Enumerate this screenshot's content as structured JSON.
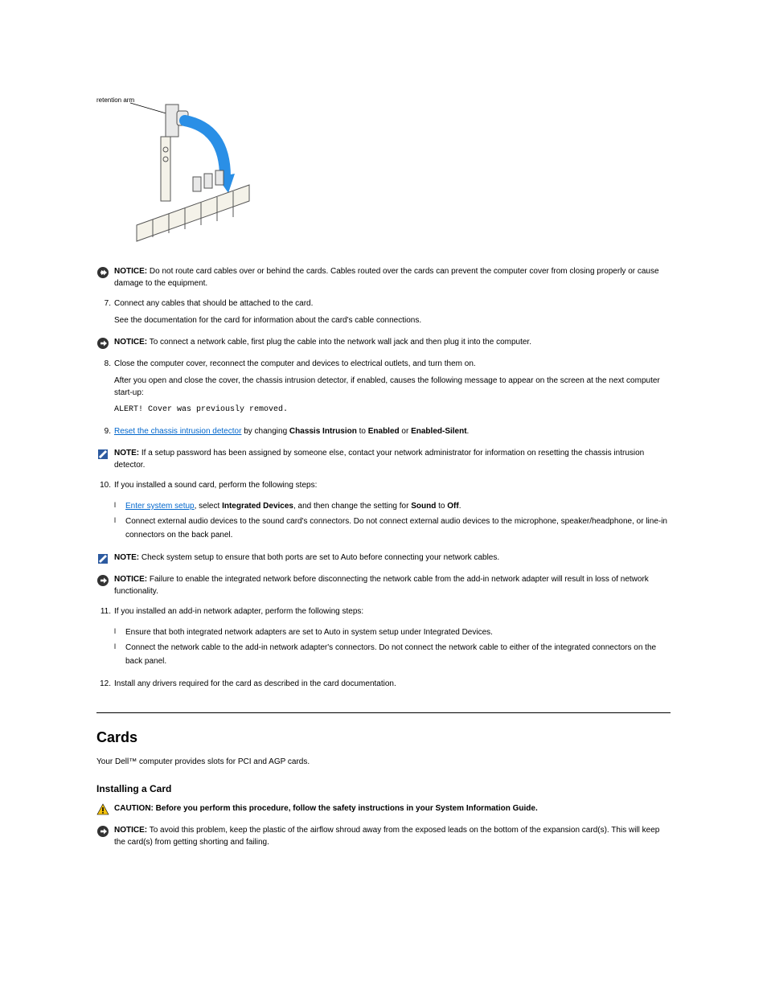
{
  "figure": {
    "label": "retention arm"
  },
  "notice7": {
    "label": "NOTICE:",
    "text": "Do not route card cables over or behind the cards. Cables routed over the cards can prevent the computer cover from closing properly or cause damage to the equipment."
  },
  "step7": {
    "num": "7.",
    "text": "Connect any cables that should be attached to the card.",
    "sub": "See the documentation for the card for information about the card's cable connections."
  },
  "notice8": {
    "label": "NOTICE:",
    "text": "To connect a network cable, first plug the cable into the network wall jack and then plug it into the computer."
  },
  "step8": {
    "num": "8.",
    "text": "Close the computer cover, reconnect the computer and devices to electrical outlets, and turn them on.",
    "sub_before": "After you open and close the cover, the chassis intrusion detector, if enabled, causes the following message to appear on the screen at the next computer start-up:",
    "code": "ALERT! Cover was previously removed."
  },
  "step9": {
    "num": "9.",
    "text_before": "Reset the chassis intrusion detector",
    "link": " by changing ",
    "text_after": "Chassis Intrusion to Enabled or Enabled-Silent.",
    "link_text": "Reset the chassis intrusion detector"
  },
  "note9": {
    "label": "NOTE:",
    "text": "If a setup password has been assigned by someone else, contact your network administrator for information on resetting the chassis intrusion detector."
  },
  "step10": {
    "num": "10.",
    "text": "If you installed a sound card, perform the following steps:",
    "items": [
      "Enter system setup, select Integrated Devices, and then change the setting for Sound to Off.",
      "Connect external audio devices to the sound card's connectors. Do not connect external audio devices to the microphone, speaker/headphone, or line-in connectors on the back panel."
    ]
  },
  "note10": {
    "label": "NOTE:",
    "text": "Check system setup to ensure that both ports are set to Auto before connecting your network cables."
  },
  "notice10": {
    "label": "NOTICE:",
    "text": "Failure to enable the integrated network before disconnecting the network cable from the add-in network adapter will result in loss of network functionality."
  },
  "step11": {
    "num": "11.",
    "text": "If you installed an add-in network adapter, perform the following steps:",
    "items": [
      "Ensure that both integrated network adapters are set to Auto in system setup under Integrated Devices.",
      "Connect the network cable to the add-in network adapter's connectors. Do not connect the network cable to either of the integrated connectors on the back panel."
    ]
  },
  "step12": {
    "num": "12.",
    "text": "Install any drivers required for the card as described in the card documentation."
  },
  "cards": {
    "title": "Cards",
    "intro": "Your Dell™ computer provides slots for PCI and AGP cards.",
    "sub_title": "Installing a Card",
    "caution": {
      "label": "CAUTION:",
      "text": "Before you perform this procedure, follow the safety instructions in your System Information Guide."
    },
    "notice": {
      "label": "NOTICE:",
      "text": "To avoid this problem, keep the plastic of the airflow shroud away from the exposed leads on the bottom of the expansion card(s). This will keep the card(s) from getting shorting and failing."
    }
  }
}
